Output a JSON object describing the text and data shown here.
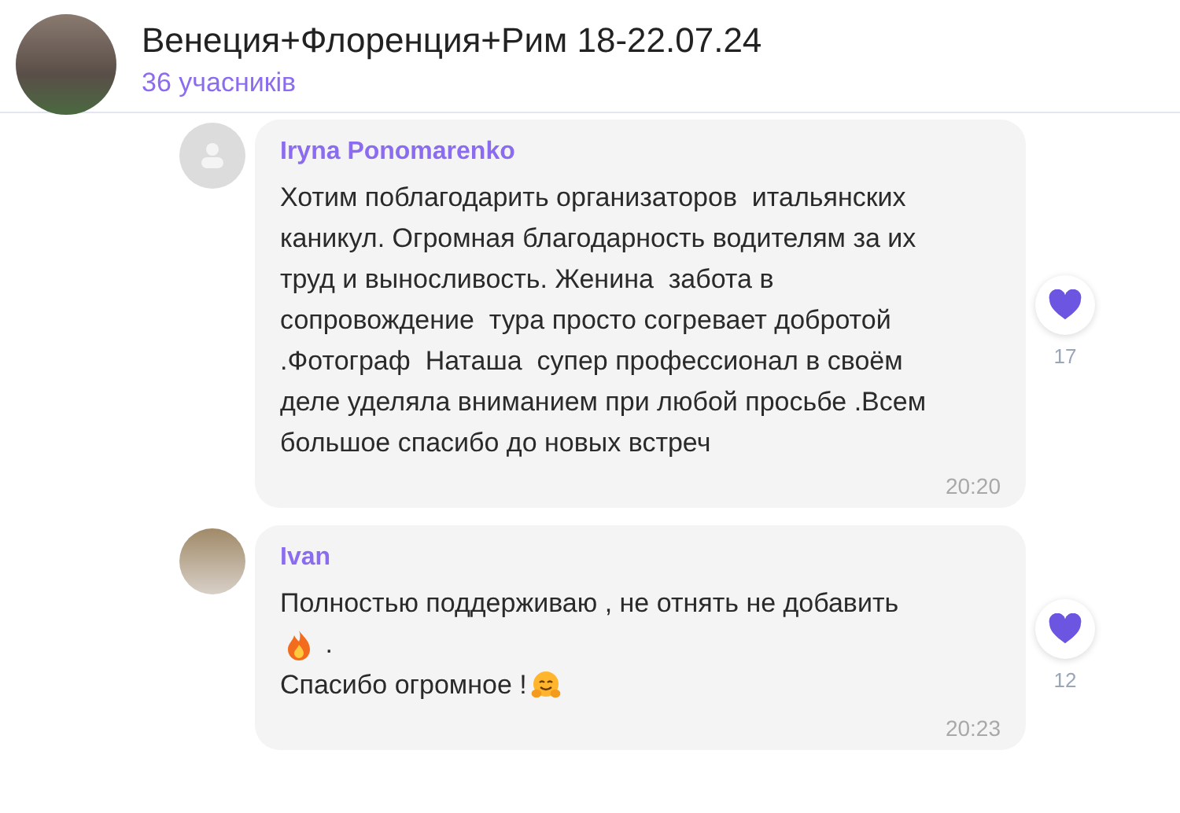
{
  "header": {
    "title": "Венеция+Флоренция+Рим 18-22.07.24",
    "subtitle": "36 учасників"
  },
  "messages": [
    {
      "author": "Iryna Ponomarenko",
      "kind": "noavatar",
      "lines": [
        [
          {
            "kind": "text",
            "text": "Хотим поблагодарить организаторов  итальянских"
          }
        ],
        [
          {
            "kind": "text",
            "text": "каникул. Огромная благодарность водителям за их"
          }
        ],
        [
          {
            "kind": "text",
            "text": "труд и выносливость. Женина  забота в"
          }
        ],
        [
          {
            "kind": "text",
            "text": "сопровождение  тура просто согревает добротой"
          }
        ],
        [
          {
            "kind": "text",
            "text": ".Фотограф  Наташа  супер профессионал в своём"
          }
        ],
        [
          {
            "kind": "text",
            "text": "деле уделяла вниманием при любой просьбе .Всем"
          }
        ],
        [
          {
            "kind": "text",
            "text": "большое спасибо до новых встреч"
          }
        ]
      ],
      "time": "20:20",
      "reaction_count": "17"
    },
    {
      "author": "Ivan",
      "kind": "photo",
      "lines": [
        [
          {
            "kind": "text",
            "text": "Полностью поддерживаю , не отнять не добавить"
          }
        ],
        [
          {
            "kind": "fire"
          },
          {
            "kind": "text",
            "text": " ."
          }
        ],
        [
          {
            "kind": "text",
            "text": "Спасибо огромное !"
          },
          {
            "kind": "hug"
          }
        ]
      ],
      "time": "20:23",
      "reaction_count": "12"
    }
  ]
}
